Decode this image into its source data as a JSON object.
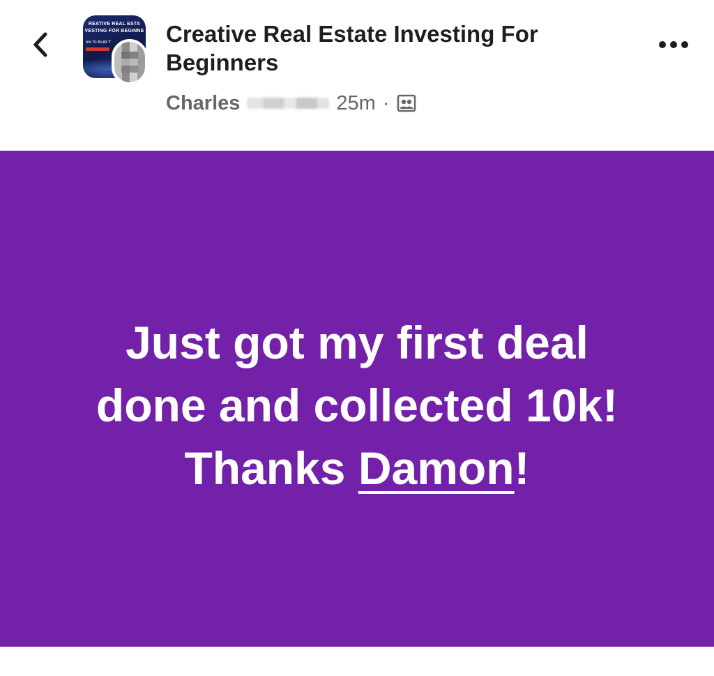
{
  "header": {
    "back_icon": "chevron-left-icon",
    "group_title": "Creative Real Estate Investing For Beginners",
    "group_avatar": {
      "line1": "REATIVE REAL ESTA",
      "line2": "VESTING FOR BEGINNE",
      "line3": "ow To Build Y"
    },
    "author_name": "Charles",
    "time": "25m",
    "separator": "·",
    "audience_icon": "group-members-icon",
    "more_icon": "more-horizontal-icon"
  },
  "post": {
    "background_color": "#7321a8",
    "text_line1": "Just got my first deal",
    "text_line2": "done and collected 10k!",
    "text_line3_prefix": "Thanks ",
    "mention": "Damon",
    "text_line3_suffix": "!"
  }
}
